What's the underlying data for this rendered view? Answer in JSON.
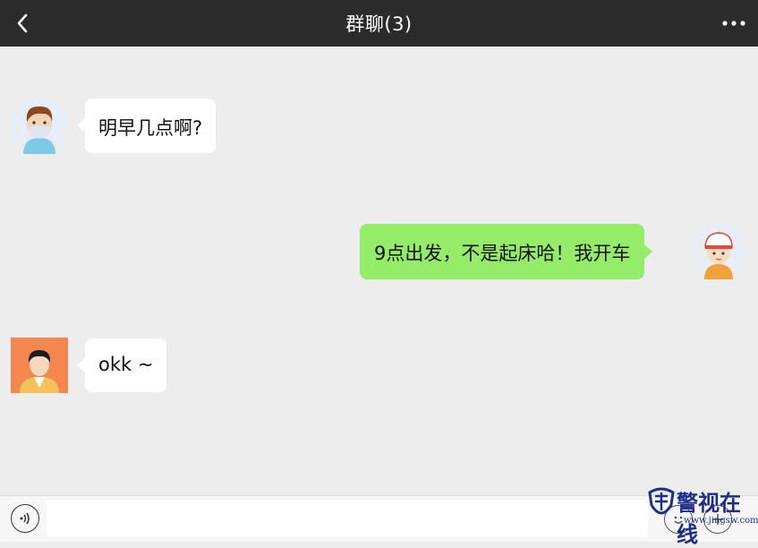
{
  "header": {
    "back_icon": "chevron-left-icon",
    "title": "群聊(3)",
    "more_icon": "more-dots-icon"
  },
  "messages": [
    {
      "sender": "other",
      "avatar": "avatar-boy-mask",
      "text": "明早几点啊?"
    },
    {
      "sender": "self",
      "avatar": "avatar-kid-cap",
      "text": "9点出发，不是起床哈！我开车"
    },
    {
      "sender": "other",
      "avatar": "avatar-man-orange",
      "text": "okk ~"
    }
  ],
  "input_bar": {
    "voice_icon": "voice-icon",
    "input_value": "",
    "emoji_icon": "emoji-icon",
    "plus_icon": "plus-icon"
  },
  "watermark": {
    "text": "警视在线",
    "url": "www.jingsw.com"
  },
  "colors": {
    "header_bg": "#2b2b2b",
    "chat_bg": "#ededed",
    "self_bubble": "#95ec69",
    "other_bubble": "#ffffff"
  }
}
